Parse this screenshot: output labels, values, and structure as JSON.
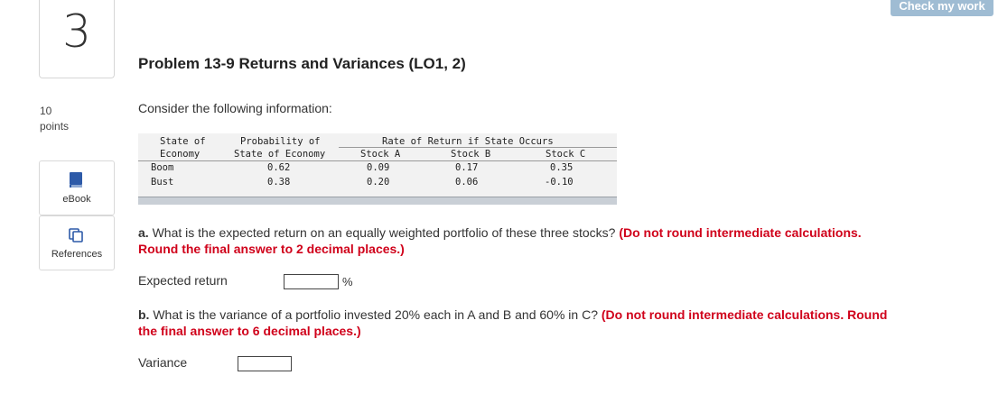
{
  "question": {
    "number": "3",
    "points_value": "10",
    "points_label": "points",
    "ebook_label": "eBook",
    "references_label": "References",
    "check_button": "Check my work"
  },
  "problem": {
    "title": "Problem 13-9 Returns and Variances (LO1, 2)",
    "intro": "Consider the following information:"
  },
  "table": {
    "header_state_1": "State of",
    "header_state_2": "Economy",
    "header_prob_1": "Probability of",
    "header_prob_2": "State of Economy",
    "header_group": "Rate of Return if State Occurs",
    "header_stock_a": "Stock A",
    "header_stock_b": "Stock B",
    "header_stock_c": "Stock C",
    "rows": [
      {
        "state": "Boom",
        "prob": "0.62",
        "a": "0.09",
        "b": "0.17",
        "c": "0.35"
      },
      {
        "state": "Bust",
        "prob": "0.38",
        "a": "0.20",
        "b": "0.06",
        "c": "-0.10"
      }
    ]
  },
  "part_a": {
    "prefix": "a.",
    "text": " What is the expected return on an equally weighted portfolio of these three stocks? ",
    "instruction_line1": "(Do not round intermediate calculations.",
    "instruction_line2": "Round the final answer to 2 decimal places.)",
    "answer_label": "Expected return",
    "answer_value": "",
    "unit": "%"
  },
  "part_b": {
    "prefix": "b.",
    "text": " What is the variance of a portfolio invested 20% each in A and B and 60% in C? ",
    "instruction_line1": "(Do not round intermediate calculations. Round",
    "instruction_line2": "the final answer to 6 decimal places.)",
    "answer_label": "Variance",
    "answer_value": ""
  },
  "colors": {
    "instruction_red": "#d0021b",
    "check_button_bg": "#9fbcd3",
    "ebook_icon": "#2d5aa8",
    "references_icon": "#2d5aa8"
  }
}
